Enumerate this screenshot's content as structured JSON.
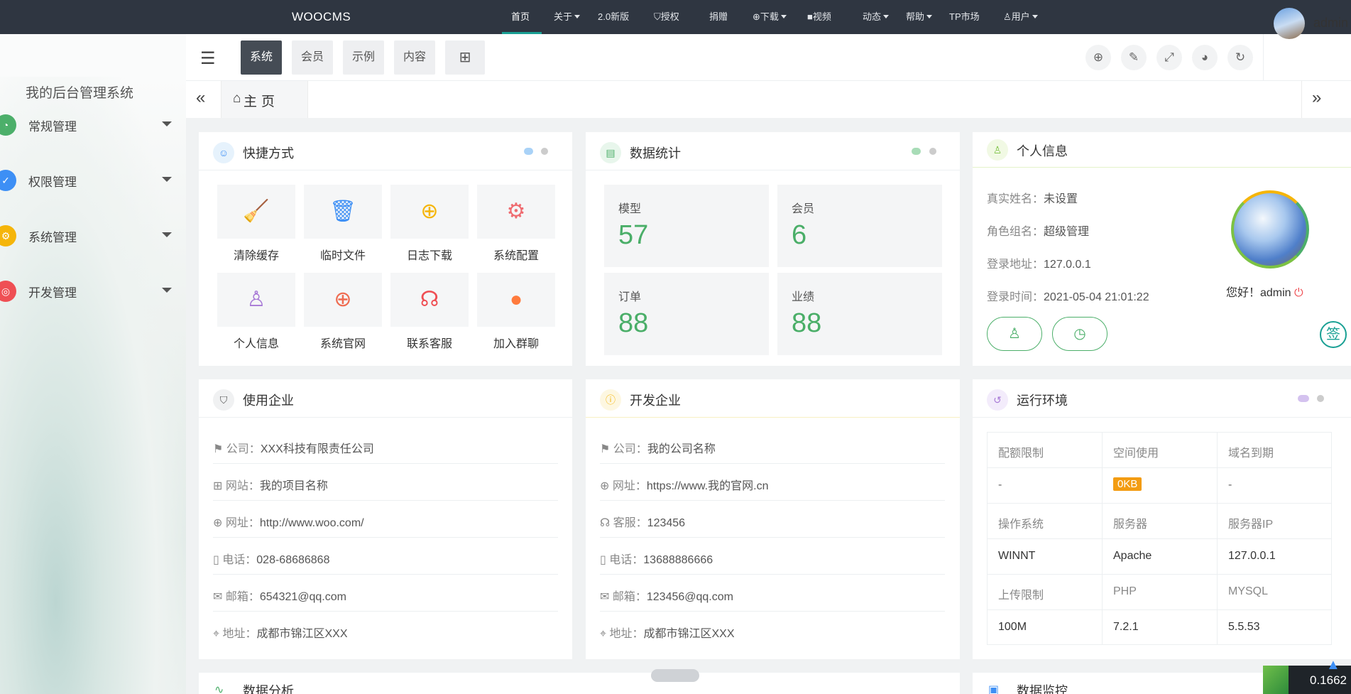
{
  "topnav": {
    "brand": "WOOCMS",
    "items": [
      {
        "label": "首页",
        "caret": false,
        "icon": ""
      },
      {
        "label": "关于",
        "caret": true,
        "icon": ""
      },
      {
        "label": "2.0新版",
        "caret": false,
        "icon": ""
      },
      {
        "label": "授权",
        "caret": false,
        "icon": "shield-icon"
      },
      {
        "label": "捐赠",
        "caret": false,
        "icon": ""
      },
      {
        "label": "下载",
        "caret": true,
        "icon": "download-icon"
      },
      {
        "label": "视频",
        "caret": false,
        "icon": "video-icon"
      },
      {
        "label": "动态",
        "caret": true,
        "icon": ""
      },
      {
        "label": "帮助",
        "caret": true,
        "icon": ""
      },
      {
        "label": "TP市场",
        "caret": false,
        "icon": ""
      },
      {
        "label": "用户",
        "caret": true,
        "icon": "user-icon"
      }
    ],
    "active_index": 0
  },
  "sidebar": {
    "title": "我的后台管理系统",
    "items": [
      {
        "label": "常规管理",
        "icon": "dashboard-icon",
        "color": "#4caf6a"
      },
      {
        "label": "权限管理",
        "icon": "shield-icon",
        "color": "#3d8ff5"
      },
      {
        "label": "系统管理",
        "icon": "gear-icon",
        "color": "#f5b50a"
      },
      {
        "label": "开发管理",
        "icon": "dev-icon",
        "color": "#ef4f54"
      }
    ]
  },
  "header": {
    "tabs": [
      "系统",
      "会员",
      "示例",
      "内容"
    ],
    "active_tab": 0,
    "tools": [
      "globe-icon",
      "brush-icon",
      "fullscreen-icon",
      "palette-icon",
      "refresh-icon"
    ],
    "admin": "admin"
  },
  "tabbar": {
    "home": "主页"
  },
  "shortcuts": {
    "title": "快捷方式",
    "items": [
      {
        "label": "清除缓存",
        "icon": "broom-icon",
        "color": "#4caf6a",
        "glyph": "🧹"
      },
      {
        "label": "临时文件",
        "icon": "trash-icon",
        "color": "#3d8ff5",
        "glyph": "🗑"
      },
      {
        "label": "日志下载",
        "icon": "download-icon",
        "color": "#f5b50a",
        "glyph": "⬇"
      },
      {
        "label": "系统配置",
        "icon": "gear-icon",
        "color": "#ef6b70",
        "glyph": "⚙"
      },
      {
        "label": "个人信息",
        "icon": "user-icon",
        "color": "#a779d6",
        "glyph": "👤"
      },
      {
        "label": "系统官网",
        "icon": "globe-icon",
        "color": "#ef6b50",
        "glyph": "🌐"
      },
      {
        "label": "联系客服",
        "icon": "headset-icon",
        "color": "#ef4f54",
        "glyph": "🎧"
      },
      {
        "label": "加入群聊",
        "icon": "qq-icon",
        "color": "#ff7b3d",
        "glyph": "🐧"
      }
    ]
  },
  "stats": {
    "title": "数据统计",
    "items": [
      {
        "label": "模型",
        "value": "57"
      },
      {
        "label": "会员",
        "value": "6"
      },
      {
        "label": "订单",
        "value": "88"
      },
      {
        "label": "业绩",
        "value": "88"
      }
    ]
  },
  "profile": {
    "title": "个人信息",
    "rows": [
      {
        "k": "真实姓名：",
        "v": "未设置"
      },
      {
        "k": "角色组名：",
        "v": "超级管理"
      },
      {
        "k": "登录地址：",
        "v": "127.0.0.1"
      },
      {
        "k": "登录时间：",
        "v": "2021-05-04 21:01:22"
      }
    ],
    "greeting": "您好！admin",
    "sign": "签"
  },
  "user_company": {
    "title": "使用企业",
    "rows": [
      {
        "icon": "flag-icon",
        "k": "公司：",
        "v": "XXX科技有限责任公司"
      },
      {
        "icon": "apps-icon",
        "k": "网站：",
        "v": "我的项目名称"
      },
      {
        "icon": "globe-icon",
        "k": "网址：",
        "v": "http://www.woo.com/"
      },
      {
        "icon": "phone-icon",
        "k": "电话：",
        "v": "028-68686868"
      },
      {
        "icon": "mail-icon",
        "k": "邮箱：",
        "v": "654321@qq.com"
      },
      {
        "icon": "location-icon",
        "k": "地址：",
        "v": "成都市锦江区XXX"
      }
    ]
  },
  "dev_company": {
    "title": "开发企业",
    "rows": [
      {
        "icon": "flag-icon",
        "k": "公司：",
        "v": "我的公司名称"
      },
      {
        "icon": "globe-icon",
        "k": "网址：",
        "v": "https://www.我的官网.cn"
      },
      {
        "icon": "headset-icon",
        "k": "客服：",
        "v": "123456"
      },
      {
        "icon": "phone-icon",
        "k": "电话：",
        "v": "13688886666"
      },
      {
        "icon": "mail-icon",
        "k": "邮箱：",
        "v": "123456@qq.com"
      },
      {
        "icon": "location-icon",
        "k": "地址：",
        "v": "成都市锦江区XXX"
      }
    ]
  },
  "env": {
    "title": "运行环境",
    "rows": [
      [
        "配额限制",
        "空间使用",
        "域名到期"
      ],
      [
        "-",
        "0KB",
        "-"
      ],
      [
        "操作系统",
        "服务器",
        "服务器IP"
      ],
      [
        "WINNT",
        "Apache",
        "127.0.0.1"
      ],
      [
        "上传限制",
        "PHP",
        "MYSQL"
      ],
      [
        "100M",
        "7.2.1",
        "5.5.53"
      ]
    ]
  },
  "bottom": {
    "left_title": "数据分析",
    "right_title": "数据监控",
    "counter": "0.1662"
  }
}
